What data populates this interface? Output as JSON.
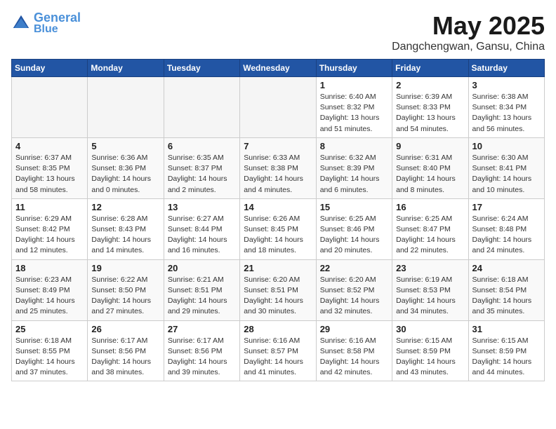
{
  "header": {
    "logo_line1": "General",
    "logo_line2": "Blue",
    "month_title": "May 2025",
    "location": "Dangchengwan, Gansu, China"
  },
  "weekdays": [
    "Sunday",
    "Monday",
    "Tuesday",
    "Wednesday",
    "Thursday",
    "Friday",
    "Saturday"
  ],
  "weeks": [
    [
      {
        "day": "",
        "info": ""
      },
      {
        "day": "",
        "info": ""
      },
      {
        "day": "",
        "info": ""
      },
      {
        "day": "",
        "info": ""
      },
      {
        "day": "1",
        "info": "Sunrise: 6:40 AM\nSunset: 8:32 PM\nDaylight: 13 hours\nand 51 minutes."
      },
      {
        "day": "2",
        "info": "Sunrise: 6:39 AM\nSunset: 8:33 PM\nDaylight: 13 hours\nand 54 minutes."
      },
      {
        "day": "3",
        "info": "Sunrise: 6:38 AM\nSunset: 8:34 PM\nDaylight: 13 hours\nand 56 minutes."
      }
    ],
    [
      {
        "day": "4",
        "info": "Sunrise: 6:37 AM\nSunset: 8:35 PM\nDaylight: 13 hours\nand 58 minutes."
      },
      {
        "day": "5",
        "info": "Sunrise: 6:36 AM\nSunset: 8:36 PM\nDaylight: 14 hours\nand 0 minutes."
      },
      {
        "day": "6",
        "info": "Sunrise: 6:35 AM\nSunset: 8:37 PM\nDaylight: 14 hours\nand 2 minutes."
      },
      {
        "day": "7",
        "info": "Sunrise: 6:33 AM\nSunset: 8:38 PM\nDaylight: 14 hours\nand 4 minutes."
      },
      {
        "day": "8",
        "info": "Sunrise: 6:32 AM\nSunset: 8:39 PM\nDaylight: 14 hours\nand 6 minutes."
      },
      {
        "day": "9",
        "info": "Sunrise: 6:31 AM\nSunset: 8:40 PM\nDaylight: 14 hours\nand 8 minutes."
      },
      {
        "day": "10",
        "info": "Sunrise: 6:30 AM\nSunset: 8:41 PM\nDaylight: 14 hours\nand 10 minutes."
      }
    ],
    [
      {
        "day": "11",
        "info": "Sunrise: 6:29 AM\nSunset: 8:42 PM\nDaylight: 14 hours\nand 12 minutes."
      },
      {
        "day": "12",
        "info": "Sunrise: 6:28 AM\nSunset: 8:43 PM\nDaylight: 14 hours\nand 14 minutes."
      },
      {
        "day": "13",
        "info": "Sunrise: 6:27 AM\nSunset: 8:44 PM\nDaylight: 14 hours\nand 16 minutes."
      },
      {
        "day": "14",
        "info": "Sunrise: 6:26 AM\nSunset: 8:45 PM\nDaylight: 14 hours\nand 18 minutes."
      },
      {
        "day": "15",
        "info": "Sunrise: 6:25 AM\nSunset: 8:46 PM\nDaylight: 14 hours\nand 20 minutes."
      },
      {
        "day": "16",
        "info": "Sunrise: 6:25 AM\nSunset: 8:47 PM\nDaylight: 14 hours\nand 22 minutes."
      },
      {
        "day": "17",
        "info": "Sunrise: 6:24 AM\nSunset: 8:48 PM\nDaylight: 14 hours\nand 24 minutes."
      }
    ],
    [
      {
        "day": "18",
        "info": "Sunrise: 6:23 AM\nSunset: 8:49 PM\nDaylight: 14 hours\nand 25 minutes."
      },
      {
        "day": "19",
        "info": "Sunrise: 6:22 AM\nSunset: 8:50 PM\nDaylight: 14 hours\nand 27 minutes."
      },
      {
        "day": "20",
        "info": "Sunrise: 6:21 AM\nSunset: 8:51 PM\nDaylight: 14 hours\nand 29 minutes."
      },
      {
        "day": "21",
        "info": "Sunrise: 6:20 AM\nSunset: 8:51 PM\nDaylight: 14 hours\nand 30 minutes."
      },
      {
        "day": "22",
        "info": "Sunrise: 6:20 AM\nSunset: 8:52 PM\nDaylight: 14 hours\nand 32 minutes."
      },
      {
        "day": "23",
        "info": "Sunrise: 6:19 AM\nSunset: 8:53 PM\nDaylight: 14 hours\nand 34 minutes."
      },
      {
        "day": "24",
        "info": "Sunrise: 6:18 AM\nSunset: 8:54 PM\nDaylight: 14 hours\nand 35 minutes."
      }
    ],
    [
      {
        "day": "25",
        "info": "Sunrise: 6:18 AM\nSunset: 8:55 PM\nDaylight: 14 hours\nand 37 minutes."
      },
      {
        "day": "26",
        "info": "Sunrise: 6:17 AM\nSunset: 8:56 PM\nDaylight: 14 hours\nand 38 minutes."
      },
      {
        "day": "27",
        "info": "Sunrise: 6:17 AM\nSunset: 8:56 PM\nDaylight: 14 hours\nand 39 minutes."
      },
      {
        "day": "28",
        "info": "Sunrise: 6:16 AM\nSunset: 8:57 PM\nDaylight: 14 hours\nand 41 minutes."
      },
      {
        "day": "29",
        "info": "Sunrise: 6:16 AM\nSunset: 8:58 PM\nDaylight: 14 hours\nand 42 minutes."
      },
      {
        "day": "30",
        "info": "Sunrise: 6:15 AM\nSunset: 8:59 PM\nDaylight: 14 hours\nand 43 minutes."
      },
      {
        "day": "31",
        "info": "Sunrise: 6:15 AM\nSunset: 8:59 PM\nDaylight: 14 hours\nand 44 minutes."
      }
    ]
  ]
}
